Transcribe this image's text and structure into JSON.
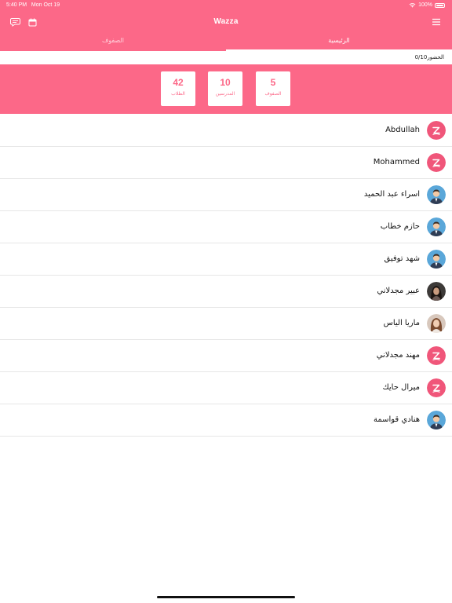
{
  "status": {
    "time": "5:40 PM",
    "date": "Mon Oct 19",
    "battery": "100%"
  },
  "header": {
    "title": "Wazza",
    "chat_icon": "chat-bubble-icon",
    "calendar_icon": "calendar-icon",
    "menu_icon": "hamburger-menu-icon"
  },
  "tabs": [
    {
      "label": "الصفوف",
      "active": false
    },
    {
      "label": "الرئيسية",
      "active": true
    }
  ],
  "attendance": {
    "text": "الحضور0/10"
  },
  "stats": [
    {
      "value": "42",
      "label": "الطلاب"
    },
    {
      "value": "10",
      "label": "المدرسين"
    },
    {
      "value": "5",
      "label": "الصفوف"
    }
  ],
  "colors": {
    "brand": "#fc6888",
    "white": "#ffffff"
  },
  "list": [
    {
      "name": "Abdullah",
      "avatar": "brand-logo-icon"
    },
    {
      "name": "Mohammed",
      "avatar": "brand-logo-icon"
    },
    {
      "name": "اسراء عبد الحميد",
      "avatar": "male-avatar-icon"
    },
    {
      "name": "حازم خطاب",
      "avatar": "male-avatar-icon"
    },
    {
      "name": "شهد توفيق",
      "avatar": "male-avatar-icon"
    },
    {
      "name": "عبير مجدلاني",
      "avatar": "female-photo-dark"
    },
    {
      "name": "ماريا الياس",
      "avatar": "female-photo-light"
    },
    {
      "name": "مهند مجدلاني",
      "avatar": "brand-logo-icon"
    },
    {
      "name": "ميرال حايك",
      "avatar": "brand-logo-icon"
    },
    {
      "name": "هنادي قواسمة",
      "avatar": "male-avatar-icon"
    }
  ]
}
